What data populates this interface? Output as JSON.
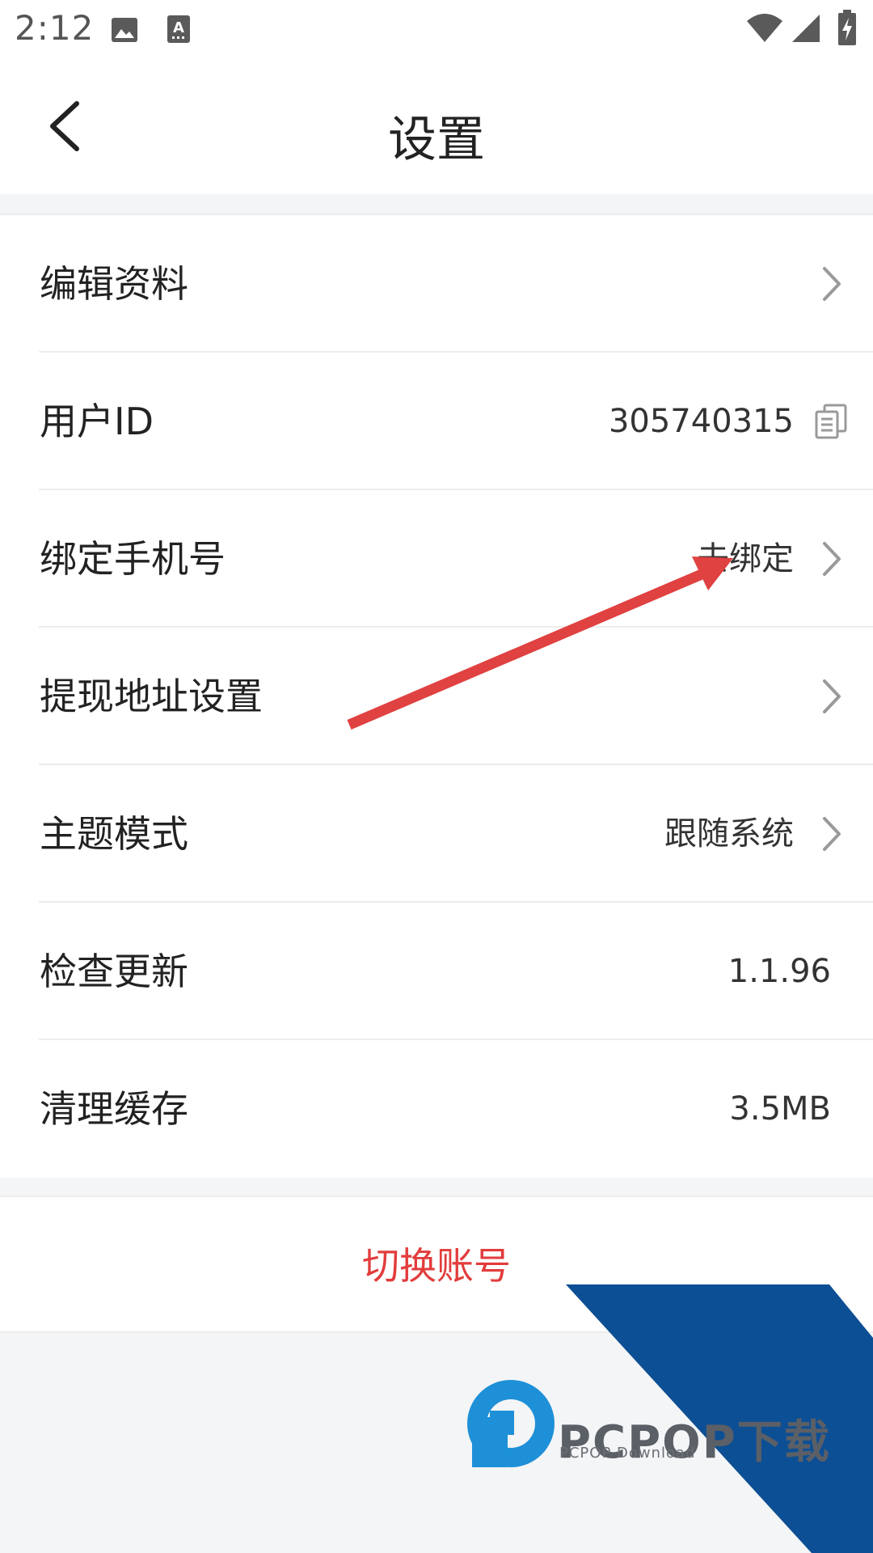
{
  "status_bar": {
    "time": "2:12",
    "icons": [
      "image-icon",
      "text-a-icon",
      "wifi-icon",
      "signal-icon",
      "battery-charging-icon"
    ]
  },
  "header": {
    "title": "设置"
  },
  "settings": {
    "items": [
      {
        "label": "编辑资料",
        "value": "",
        "trailing": "chevron"
      },
      {
        "label": "用户ID",
        "value": "305740315",
        "trailing": "copy"
      },
      {
        "label": "绑定手机号",
        "value": "去绑定",
        "trailing": "chevron"
      },
      {
        "label": "提现地址设置",
        "value": "",
        "trailing": "chevron"
      },
      {
        "label": "主题模式",
        "value": "跟随系统",
        "trailing": "chevron"
      },
      {
        "label": "检查更新",
        "value": "1.1.96",
        "trailing": "none"
      },
      {
        "label": "清理缓存",
        "value": "3.5MB",
        "trailing": "none"
      }
    ]
  },
  "switch_account": {
    "label": "切换账号"
  },
  "watermark": {
    "text": "PCPOP下载",
    "subtext": "PCPOP Download"
  },
  "colors": {
    "accent_red": "#e23c3c",
    "arrow_red": "#e04141",
    "watermark_blue": "#0d4f94",
    "logo_blue": "#1e90d8"
  }
}
